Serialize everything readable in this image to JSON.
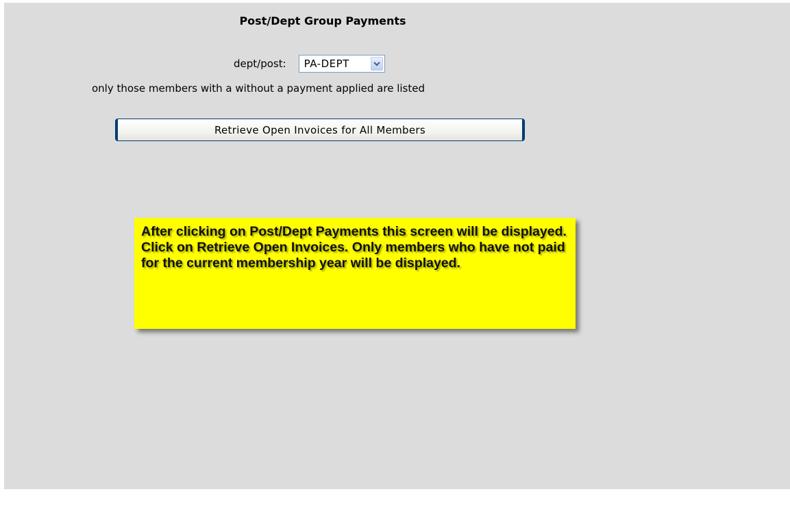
{
  "page": {
    "title": "Post/Dept Group Payments"
  },
  "dept_post": {
    "label": "dept/post:",
    "selected": "PA-DEPT"
  },
  "note": "only those members with a without a payment applied are listed",
  "retrieve_button": {
    "label": "Retrieve Open Invoices for All Members"
  },
  "callout": {
    "text": "After clicking on Post/Dept Payments this screen will be displayed.  Click on Retrieve Open Invoices.  Only members who have not paid for the current membership year will be displayed."
  },
  "icons": {
    "dropdown": "chevron-down-icon"
  },
  "colors": {
    "background": "#dcdcdc",
    "callout": "#ffff00",
    "button_border": "#003c74"
  }
}
